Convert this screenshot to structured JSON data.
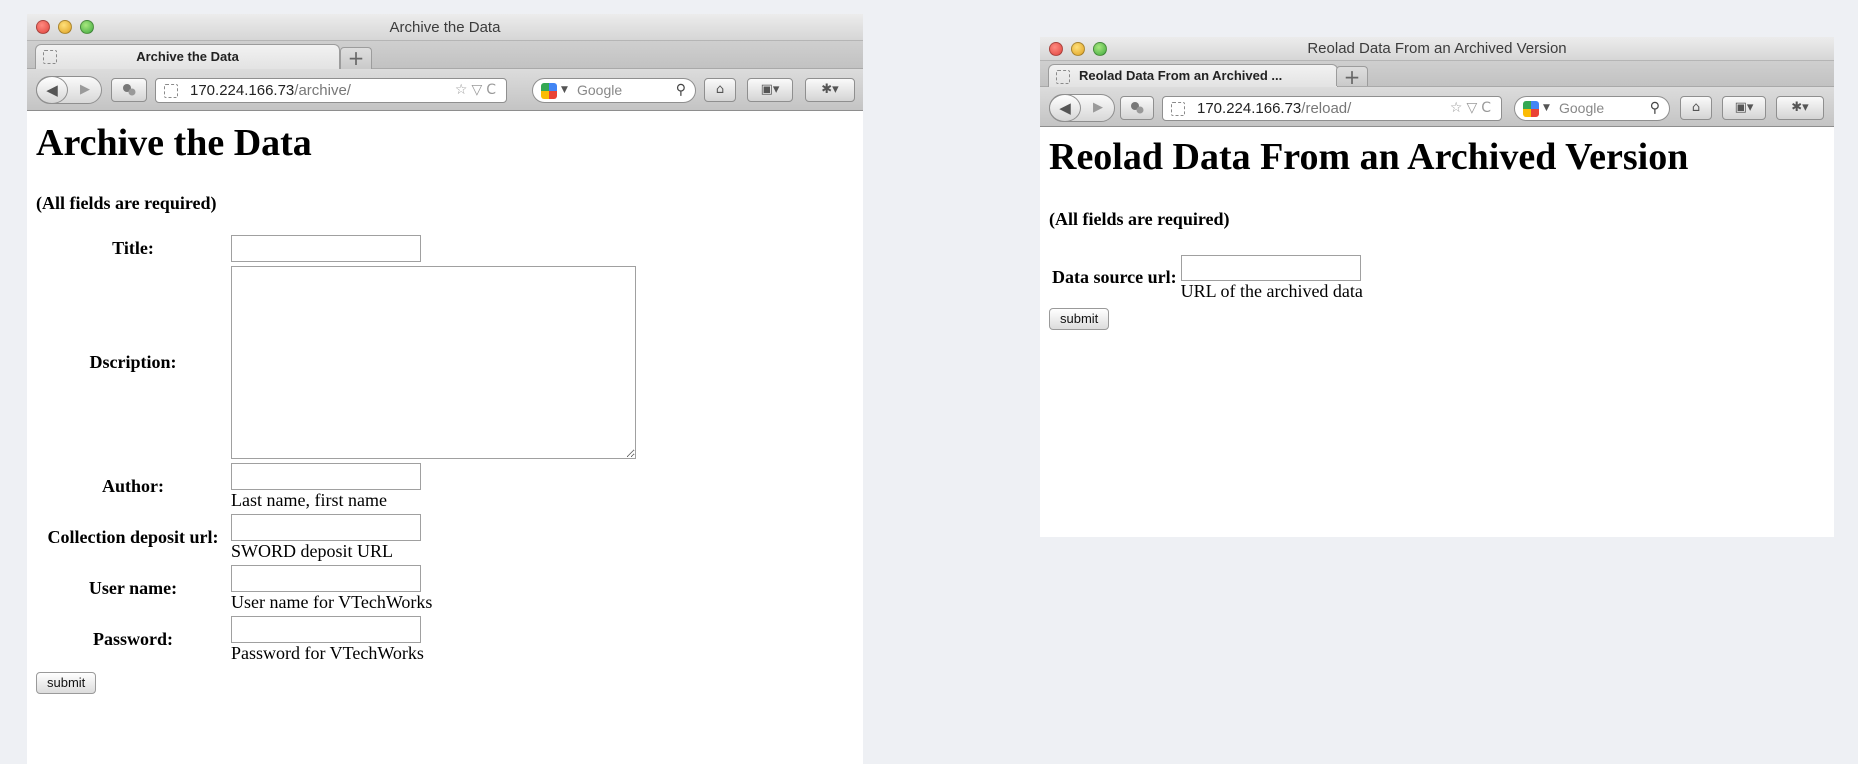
{
  "left_window": {
    "window_title": "Archive the Data",
    "tab_title": "Archive the Data",
    "new_tab_symbol": "+",
    "url_host": "170.224.166.73",
    "url_path": "/archive/",
    "search_placeholder": "Google",
    "page": {
      "heading": "Archive the Data",
      "required_note": "(All fields are required)",
      "fields": [
        {
          "label": "Title:",
          "hint": ""
        },
        {
          "label": "Dscription:",
          "hint": ""
        },
        {
          "label": "Author:",
          "hint": "Last name, first name"
        },
        {
          "label": "Collection deposit url:",
          "hint": "SWORD deposit URL"
        },
        {
          "label": "User name:",
          "hint": "User name for VTechWorks"
        },
        {
          "label": "Password:",
          "hint": "Password for VTechWorks"
        }
      ],
      "submit_label": "submit"
    }
  },
  "right_window": {
    "window_title": "Reolad Data From an Archived Version",
    "tab_title": "Reolad Data From an Archived ...",
    "new_tab_symbol": "+",
    "url_host": "170.224.166.73",
    "url_path": "/reload/",
    "search_placeholder": "Google",
    "page": {
      "heading": "Reolad Data From an Archived Version",
      "required_note": "(All fields are required)",
      "fields": [
        {
          "label": "Data source url:",
          "hint": "URL of the archived data"
        }
      ],
      "submit_label": "submit"
    }
  },
  "icons": {
    "back": "◀",
    "forward": "▶",
    "reload": "C",
    "bookmark_star": "☆",
    "dropdown": "▽",
    "home": "⌂",
    "search": "🔍"
  }
}
